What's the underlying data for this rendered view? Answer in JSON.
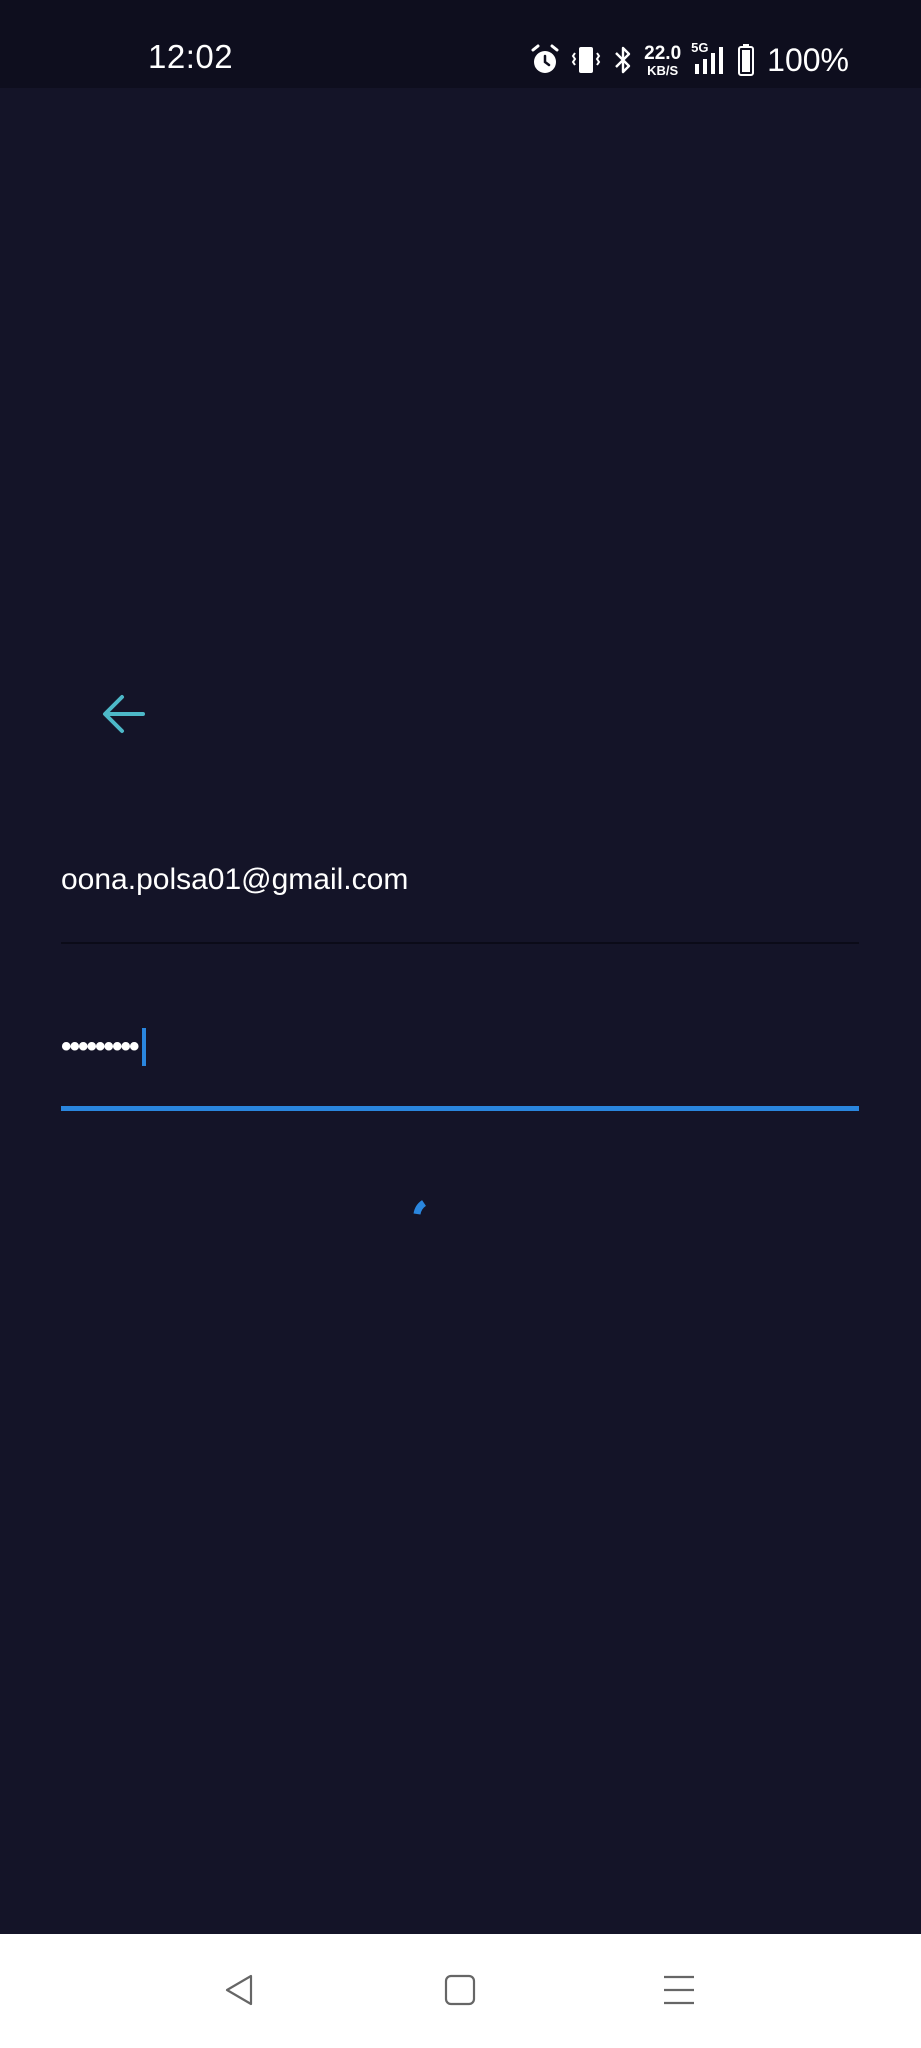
{
  "status_bar": {
    "time": "12:02",
    "network_speed_value": "22.0",
    "network_speed_unit": "KB/S",
    "network_type": "5G",
    "battery_percent": "100%",
    "icons": [
      "alarm-icon",
      "vibrate-icon",
      "bluetooth-icon",
      "signal-icon",
      "battery-icon"
    ]
  },
  "form": {
    "email_value": "oona.polsa01@gmail.com",
    "password_masked": "•••••••••"
  },
  "nav_bar": {
    "icons": [
      "back-nav-icon",
      "home-nav-icon",
      "menu-nav-icon"
    ]
  },
  "colors": {
    "background": "#141428",
    "status_bar": "#0e0e1e",
    "accent": "#2a86de",
    "back_arrow": "#4db8c8",
    "nav_bar": "#ffffff"
  }
}
